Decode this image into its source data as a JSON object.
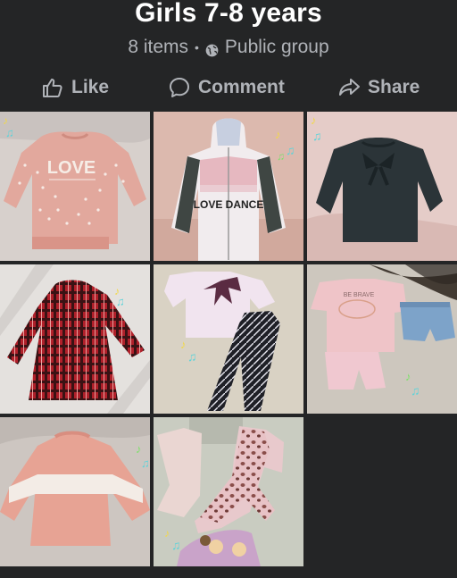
{
  "group": {
    "title": "Girls 7-8 years",
    "item_count": "8 items",
    "separator": "•",
    "privacy": "Public group",
    "privacy_icon": "globe-icon"
  },
  "actions": [
    {
      "label": "Like",
      "icon": "thumbs-up-icon"
    },
    {
      "label": "Comment",
      "icon": "speech-bubble-icon"
    },
    {
      "label": "Share",
      "icon": "share-arrow-icon"
    }
  ],
  "photos": [
    {
      "description": "Pink sweatshirt with LOVE print",
      "print_text": "LOVE"
    },
    {
      "description": "Pink white and grey zip hoodie",
      "print_text": "LOVE DANCE"
    },
    {
      "description": "Black sweatshirt with bow"
    },
    {
      "description": "Red plaid dress"
    },
    {
      "description": "Pink t-shirt with bow and patterned leggings"
    },
    {
      "description": "Pink t-shirt, pink shorts and denim shorts",
      "print_text": "BE BRAVE"
    },
    {
      "description": "Pink and white fluffy sweater"
    },
    {
      "description": "Pink trousers, leopard pajamas and printed top"
    }
  ],
  "colors": {
    "background": "#242526",
    "text_primary": "#ffffff",
    "text_secondary": "#b0b3b8"
  }
}
